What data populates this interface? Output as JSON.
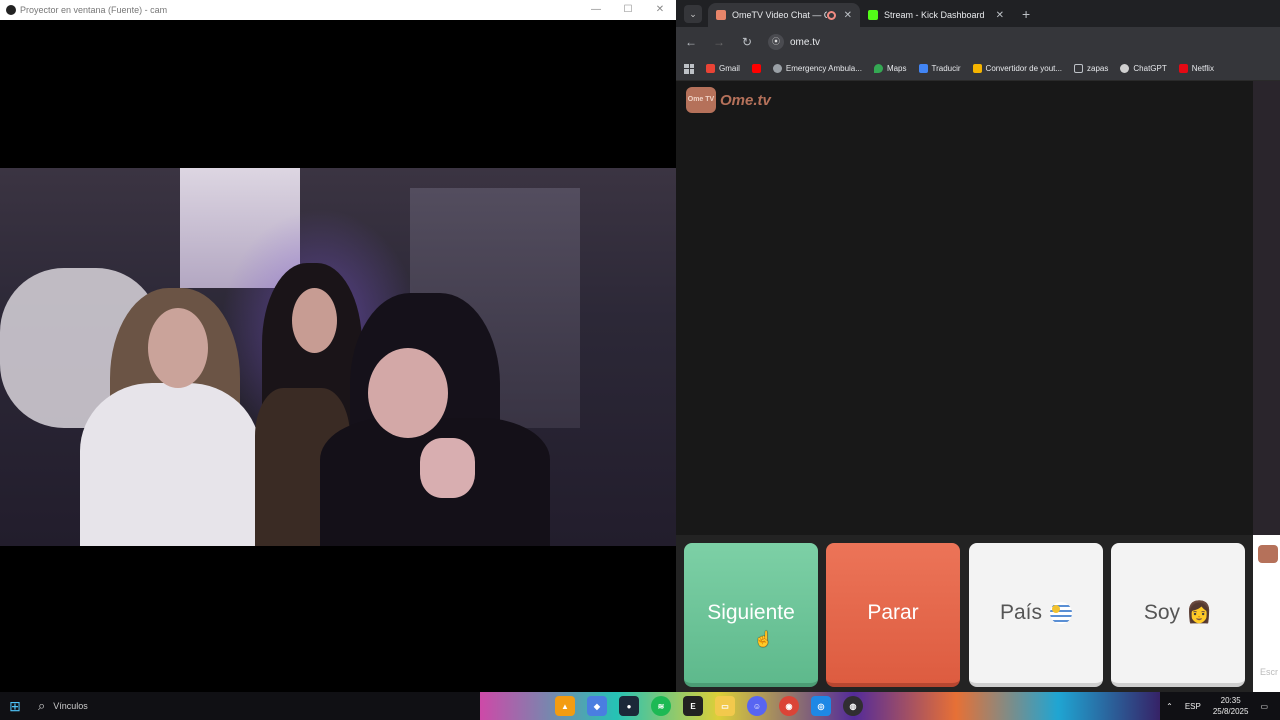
{
  "projector": {
    "title": "Proyector en ventana (Fuente) - cam",
    "controls": [
      "—",
      "☐",
      "✕"
    ]
  },
  "browser": {
    "tabs": [
      {
        "label": "OmeTV Video Chat — Ome",
        "active": true,
        "favicon_color": "#e8856a"
      },
      {
        "label": "Stream - Kick Dashboard",
        "active": false,
        "favicon_color": "#53fc18"
      }
    ],
    "tab_close": "✕",
    "new_tab": "+",
    "url": "ome.tv",
    "bookmarks": [
      {
        "label": "Gmail",
        "color": "#ea4335"
      },
      {
        "label": "",
        "color": "#ff0000"
      },
      {
        "label": "Emergency Ambula...",
        "color": "#9aa0a6"
      },
      {
        "label": "Maps",
        "color": "#34a853"
      },
      {
        "label": "Traducir",
        "color": "#4285f4"
      },
      {
        "label": "Convertidor de yout...",
        "color": "#f5b400"
      },
      {
        "label": "zapas",
        "color": "#9aa0a6"
      },
      {
        "label": "ChatGPT",
        "color": "#d0d0d0"
      },
      {
        "label": "Netflix",
        "color": "#e50914"
      }
    ]
  },
  "ometv": {
    "logo_badge": "Ome TV",
    "logo_text": "Ome.tv",
    "buttons": {
      "next": "Siguiente",
      "stop": "Parar",
      "country": "País",
      "gender": "Soy",
      "gender_emoji": "👩"
    },
    "chat_placeholder": "Escr"
  },
  "taskbar": {
    "search_label": "Vínculos",
    "language": "ESP",
    "time": "20:35",
    "date": "25/8/2025"
  }
}
